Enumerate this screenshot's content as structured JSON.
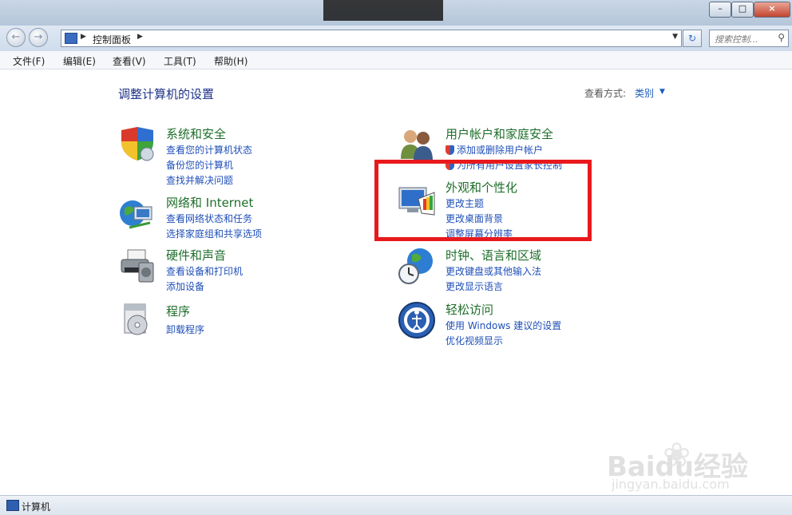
{
  "window": {
    "min_glyph": "–",
    "max_glyph": "□",
    "close_glyph": "×"
  },
  "nav": {
    "back_glyph": "←",
    "forward_glyph": "→",
    "breadcrumb": "控制面板",
    "search_placeholder": "搜索控制...",
    "refresh_glyph": "↻"
  },
  "menu": [
    "文件(F)",
    "编辑(E)",
    "查看(V)",
    "工具(T)",
    "帮助(H)"
  ],
  "header": {
    "title": "调整计算机的设置",
    "view_label": "查看方式:",
    "view_value": "类别"
  },
  "categories": [
    {
      "icon": "shield-icon",
      "title": "系统和安全",
      "links": [
        "查看您的计算机状态",
        "备份您的计算机",
        "查找并解决问题"
      ]
    },
    {
      "icon": "network-globe-icon",
      "title": "网络和 Internet",
      "links": [
        "查看网络状态和任务",
        "选择家庭组和共享选项"
      ]
    },
    {
      "icon": "printer-icon",
      "title": "硬件和声音",
      "links": [
        "查看设备和打印机",
        "添加设备"
      ]
    },
    {
      "icon": "programs-icon",
      "title": "程序",
      "links": [
        "卸载程序"
      ]
    },
    {
      "icon": "users-icon",
      "title": "用户帐户和家庭安全",
      "links": [
        "添加或删除用户帐户",
        "为所有用户设置家长控制"
      ]
    },
    {
      "icon": "monitor-palette-icon",
      "title": "外观和个性化",
      "links": [
        "更改主题",
        "更改桌面背景",
        "调整屏幕分辨率"
      ]
    },
    {
      "icon": "clock-globe-icon",
      "title": "时钟、语言和区域",
      "links": [
        "更改键盘或其他输入法",
        "更改显示语言"
      ]
    },
    {
      "icon": "ease-of-access-icon",
      "title": "轻松访问",
      "links": [
        "使用 Windows 建议的设置",
        "优化视频显示"
      ]
    }
  ],
  "status": {
    "text": "计算机"
  },
  "watermark": {
    "brand": "Baidu经验",
    "url": "jingyan.baidu.com"
  },
  "colors": {
    "highlight": "#e8191c",
    "link": "#1f4fb8",
    "category_title": "#1e6e2a",
    "page_title": "#1e3287"
  }
}
